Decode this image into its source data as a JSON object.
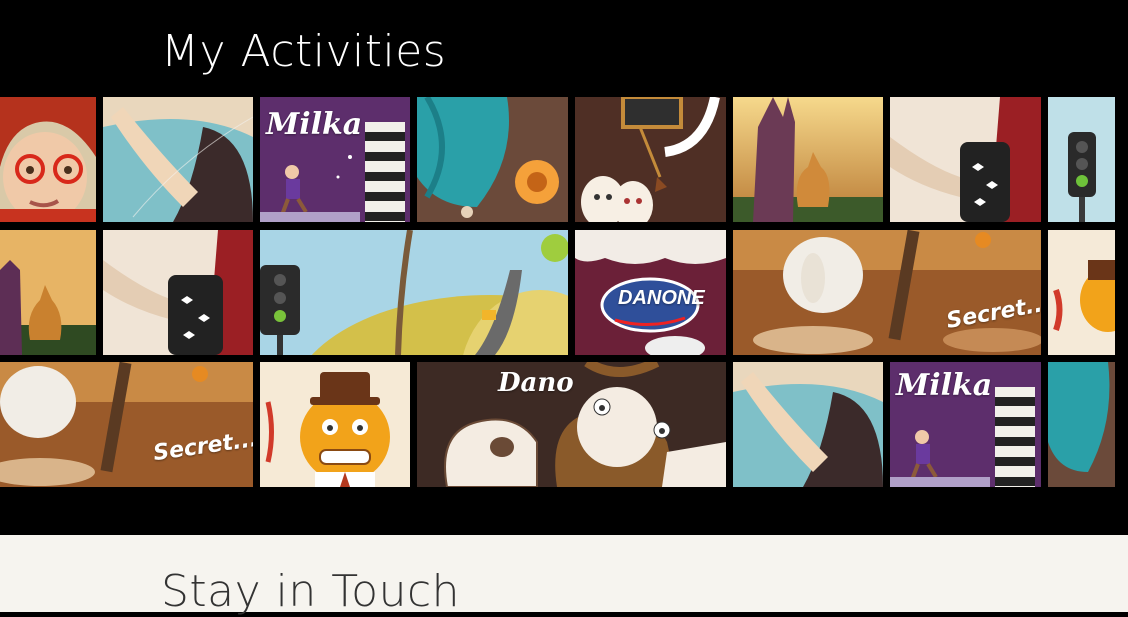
{
  "sections": {
    "activities_title": "My Activities",
    "contact_title": "Stay in Touch"
  },
  "tiles": {
    "milka_1": "Milka",
    "danone": "DANONE",
    "secret_1": "Secret...",
    "secret_2": "Secret...",
    "dano": "Dano",
    "milka_2": "Milka"
  },
  "colors": {
    "background_dark": "#000000",
    "background_light": "#f6f4ef",
    "heading_light": "#ffffff",
    "heading_dark": "#333333"
  }
}
